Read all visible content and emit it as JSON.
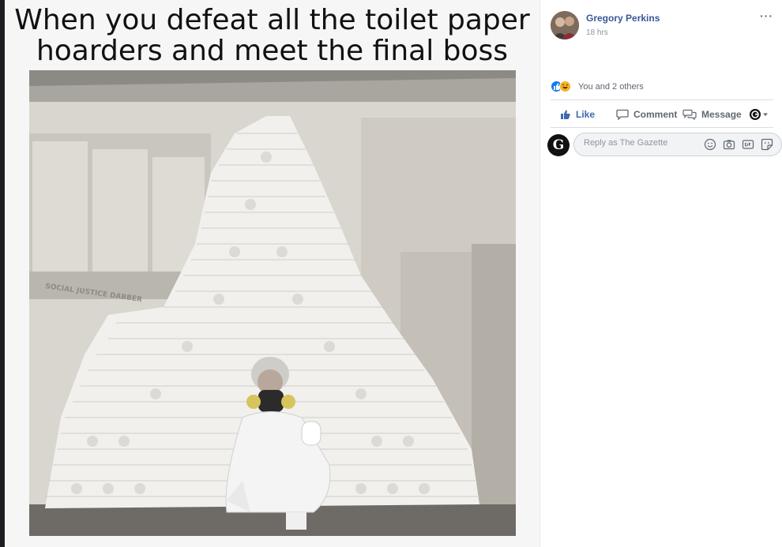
{
  "post": {
    "caption_line1": "When you defeat all the toilet paper",
    "caption_line2": "hoarders and meet the final boss",
    "photo_watermark": "SOCIAL JUSTICE DABBER"
  },
  "sidebar": {
    "author_name": "Gregory Perkins",
    "post_time": "18 hrs",
    "more_label": "···",
    "reactions": {
      "icons": [
        "like-icon",
        "haha-icon"
      ],
      "count_text": "You and 2 others"
    },
    "actions": {
      "like_label": "Like",
      "comment_label": "Comment",
      "message_label": "Message"
    },
    "reply": {
      "avatar_letter": "G",
      "placeholder": "Reply as The Gazette",
      "icons": [
        "emoji-icon",
        "camera-icon",
        "gif-icon",
        "sticker-icon"
      ]
    }
  },
  "colors": {
    "link_blue": "#385898",
    "like_blue": "#4267b2",
    "reaction_like": "#1877f2",
    "reaction_haha": "#f7b125"
  }
}
